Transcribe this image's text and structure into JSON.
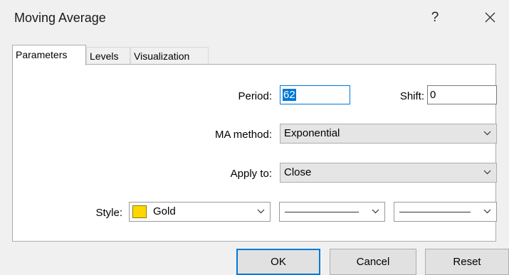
{
  "window": {
    "title": "Moving Average",
    "help_label": "?"
  },
  "tabs": [
    {
      "label": "Parameters",
      "active": true
    },
    {
      "label": "Levels",
      "active": false
    },
    {
      "label": "Visualization",
      "active": false
    }
  ],
  "parameters": {
    "period_label": "Period:",
    "period_value": "62",
    "shift_label": "Shift:",
    "shift_value": "0",
    "ma_method_label": "MA method:",
    "ma_method_value": "Exponential",
    "apply_to_label": "Apply to:",
    "apply_to_value": "Close",
    "style_label": "Style:",
    "style_color_name": "Gold",
    "style_color_hex": "#ffd700"
  },
  "buttons": {
    "ok": "OK",
    "cancel": "Cancel",
    "reset": "Reset"
  },
  "colors": {
    "focus_accent": "#0078d7",
    "dialog_bg": "#f0f0f0"
  }
}
